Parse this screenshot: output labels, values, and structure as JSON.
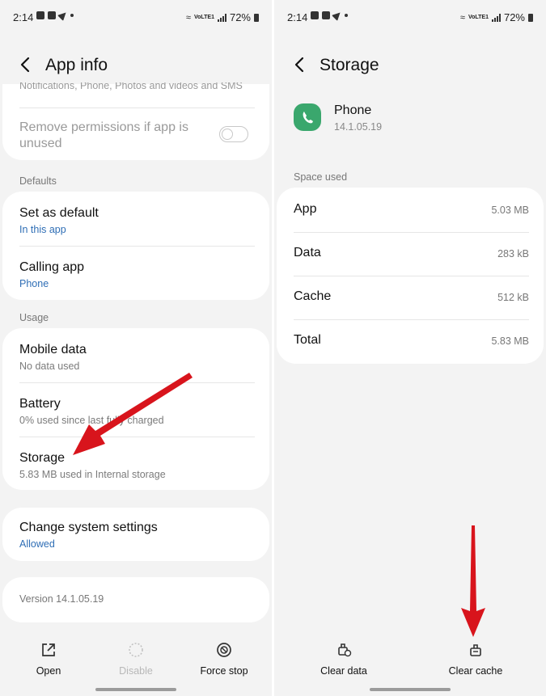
{
  "status_bar": {
    "time": "2:14",
    "battery": "72%",
    "network": "VoLTE1"
  },
  "left": {
    "title": "App info",
    "truncated_text": "Notifications, Phone, Photos and videos and SMS",
    "remove_permissions": "Remove permissions if app is unused",
    "sections": {
      "defaults": "Defaults",
      "usage": "Usage"
    },
    "set_as_default": {
      "title": "Set as default",
      "subtitle": "In this app"
    },
    "calling_app": {
      "title": "Calling app",
      "subtitle": "Phone"
    },
    "mobile_data": {
      "title": "Mobile data",
      "subtitle": "No data used"
    },
    "battery": {
      "title": "Battery",
      "subtitle": "0% used since last fully charged"
    },
    "storage": {
      "title": "Storage",
      "subtitle": "5.83 MB used in Internal storage"
    },
    "change_system_settings": {
      "title": "Change system settings",
      "subtitle": "Allowed"
    },
    "version": "Version 14.1.05.19",
    "bottom_actions": {
      "open": "Open",
      "disable": "Disable",
      "force_stop": "Force stop"
    }
  },
  "right": {
    "title": "Storage",
    "app_name": "Phone",
    "app_version": "14.1.05.19",
    "space_used_label": "Space used",
    "rows": [
      {
        "label": "App",
        "value": "5.03 MB"
      },
      {
        "label": "Data",
        "value": "283 kB"
      },
      {
        "label": "Cache",
        "value": "512 kB"
      },
      {
        "label": "Total",
        "value": "5.83 MB"
      }
    ],
    "bottom_actions": {
      "clear_data": "Clear data",
      "clear_cache": "Clear cache"
    }
  },
  "colors": {
    "accent_blue": "#2f6eb5",
    "arrow_red": "#d8141c",
    "phone_green": "#3aa76d"
  }
}
